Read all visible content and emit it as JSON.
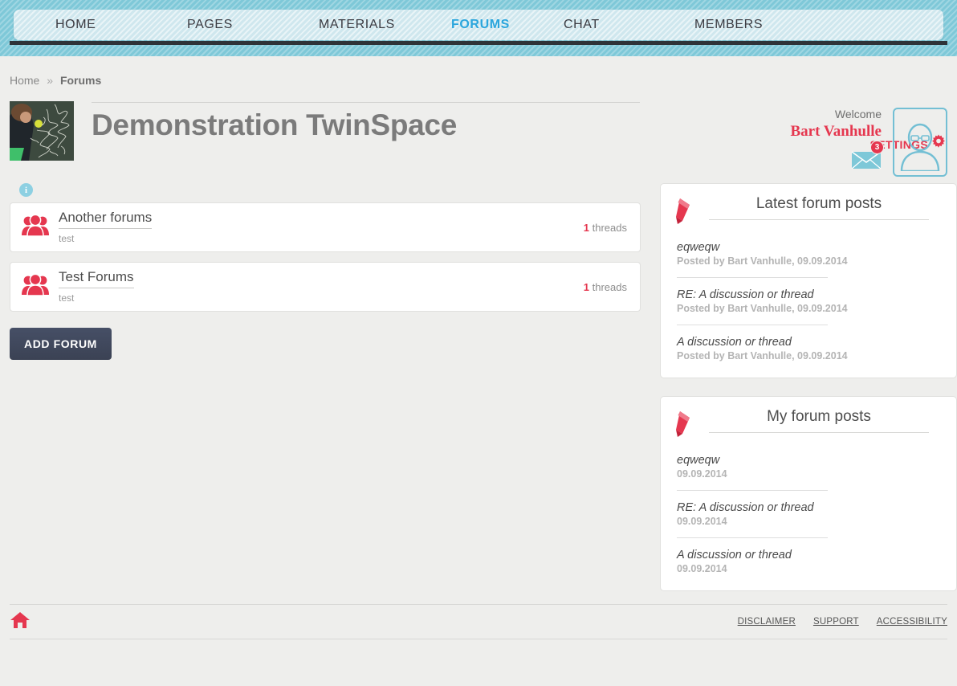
{
  "nav": {
    "items": [
      {
        "label": "HOME",
        "active": false
      },
      {
        "label": "PAGES",
        "active": false
      },
      {
        "label": "MATERIALS",
        "active": false
      },
      {
        "label": "FORUMS",
        "active": true
      },
      {
        "label": "CHAT",
        "active": false
      },
      {
        "label": "MEMBERS",
        "active": false
      }
    ]
  },
  "breadcrumb": {
    "home": "Home",
    "separator": "»",
    "current": "Forums"
  },
  "settings": {
    "label": "SETTINGS",
    "icon": "gear-icon"
  },
  "header": {
    "title": "Demonstration TwinSpace",
    "thumbnail_alt": "teacher drawing chalk map of Europe on blackboard"
  },
  "user": {
    "welcome_label": "Welcome",
    "name": "Bart Vanhulle",
    "messages_count": "3",
    "mail_icon": "envelope-icon",
    "avatar_icon": "user-avatar-icon"
  },
  "forums": {
    "info_icon_label": "i",
    "threads_suffix": "threads",
    "items": [
      {
        "title": "Another forums",
        "description": "test",
        "thread_count": "1",
        "thread_label": "threads"
      },
      {
        "title": "Test Forums",
        "description": "test",
        "thread_count": "1",
        "thread_label": "threads"
      }
    ],
    "add_button": "ADD FORUM"
  },
  "panels": [
    {
      "id": "latest-forum-posts",
      "title": "Latest forum posts",
      "icon": "pencil-icon",
      "posts": [
        {
          "title": "eqweqw",
          "meta": "Posted by Bart Vanhulle, 09.09.2014"
        },
        {
          "title": "RE: A discussion or thread",
          "meta": "Posted by Bart Vanhulle, 09.09.2014"
        },
        {
          "title": "A discussion or thread",
          "meta": "Posted by Bart Vanhulle, 09.09.2014"
        }
      ]
    },
    {
      "id": "my-forum-posts",
      "title": "My forum posts",
      "icon": "pencil-icon",
      "posts": [
        {
          "title": "eqweqw",
          "meta": "09.09.2014"
        },
        {
          "title": "RE: A discussion or thread",
          "meta": "09.09.2014"
        },
        {
          "title": "A discussion or thread",
          "meta": "09.09.2014"
        }
      ]
    }
  ],
  "footer": {
    "home_icon": "home-icon",
    "links": [
      {
        "label": "DISCLAIMER"
      },
      {
        "label": "SUPPORT"
      },
      {
        "label": "ACCESSIBILITY"
      }
    ]
  },
  "colors": {
    "accent_red": "#e5374f",
    "accent_teal": "#7ec8d8",
    "nav_active_blue": "#2ba6dd",
    "button_navy": "#3f4760",
    "page_bg": "#eeeeec",
    "info_blue": "#8dd0e2"
  }
}
